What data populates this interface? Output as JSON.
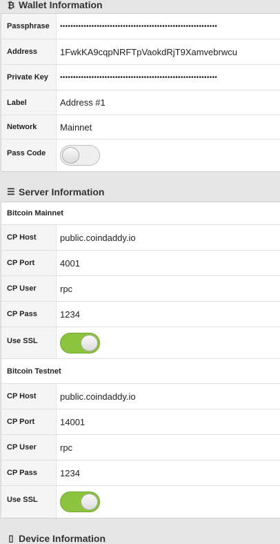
{
  "wallet": {
    "header_icon": "bitcoin-icon",
    "header_glyph": "₿",
    "header": "Wallet Information",
    "passphrase_label": "Passphrase",
    "passphrase_value": "••••••••••••••••••••••••••••••••••••••••••••••••••••••••••••",
    "address_label": "Address",
    "address_value": "1FwkKA9cqpNRFTpVaokdRjT9Xamvebrwcu",
    "private_key_label": "Private Key",
    "private_key_value": "••••••••••••••••••••••••••••••••••••••••••••••••••••••••••••",
    "label_label": "Label",
    "label_value": "Address #1",
    "network_label": "Network",
    "network_value": "Mainnet",
    "pass_code_label": "Pass Code",
    "pass_code_on": false
  },
  "server": {
    "header_icon": "server-icon",
    "header_glyph": "☰",
    "header": "Server Information",
    "mainnet": {
      "title": "Bitcoin Mainnet",
      "host_label": "CP Host",
      "host_value": "public.coindaddy.io",
      "port_label": "CP Port",
      "port_value": "4001",
      "user_label": "CP User",
      "user_value": "rpc",
      "pass_label": "CP Pass",
      "pass_value": "1234",
      "ssl_label": "Use SSL",
      "ssl_on": true
    },
    "testnet": {
      "title": "Bitcoin Testnet",
      "host_label": "CP Host",
      "host_value": "public.coindaddy.io",
      "port_label": "CP Port",
      "port_value": "14001",
      "user_label": "CP User",
      "user_value": "rpc",
      "pass_label": "CP Pass",
      "pass_value": "1234",
      "ssl_label": "Use SSL",
      "ssl_on": true
    }
  },
  "device": {
    "header_icon": "mobile-phone-icon",
    "header_glyph": "▯",
    "header": "Device Information"
  },
  "colors": {
    "toggle_on": "#8cc43f",
    "background": "#e6e6e6"
  }
}
